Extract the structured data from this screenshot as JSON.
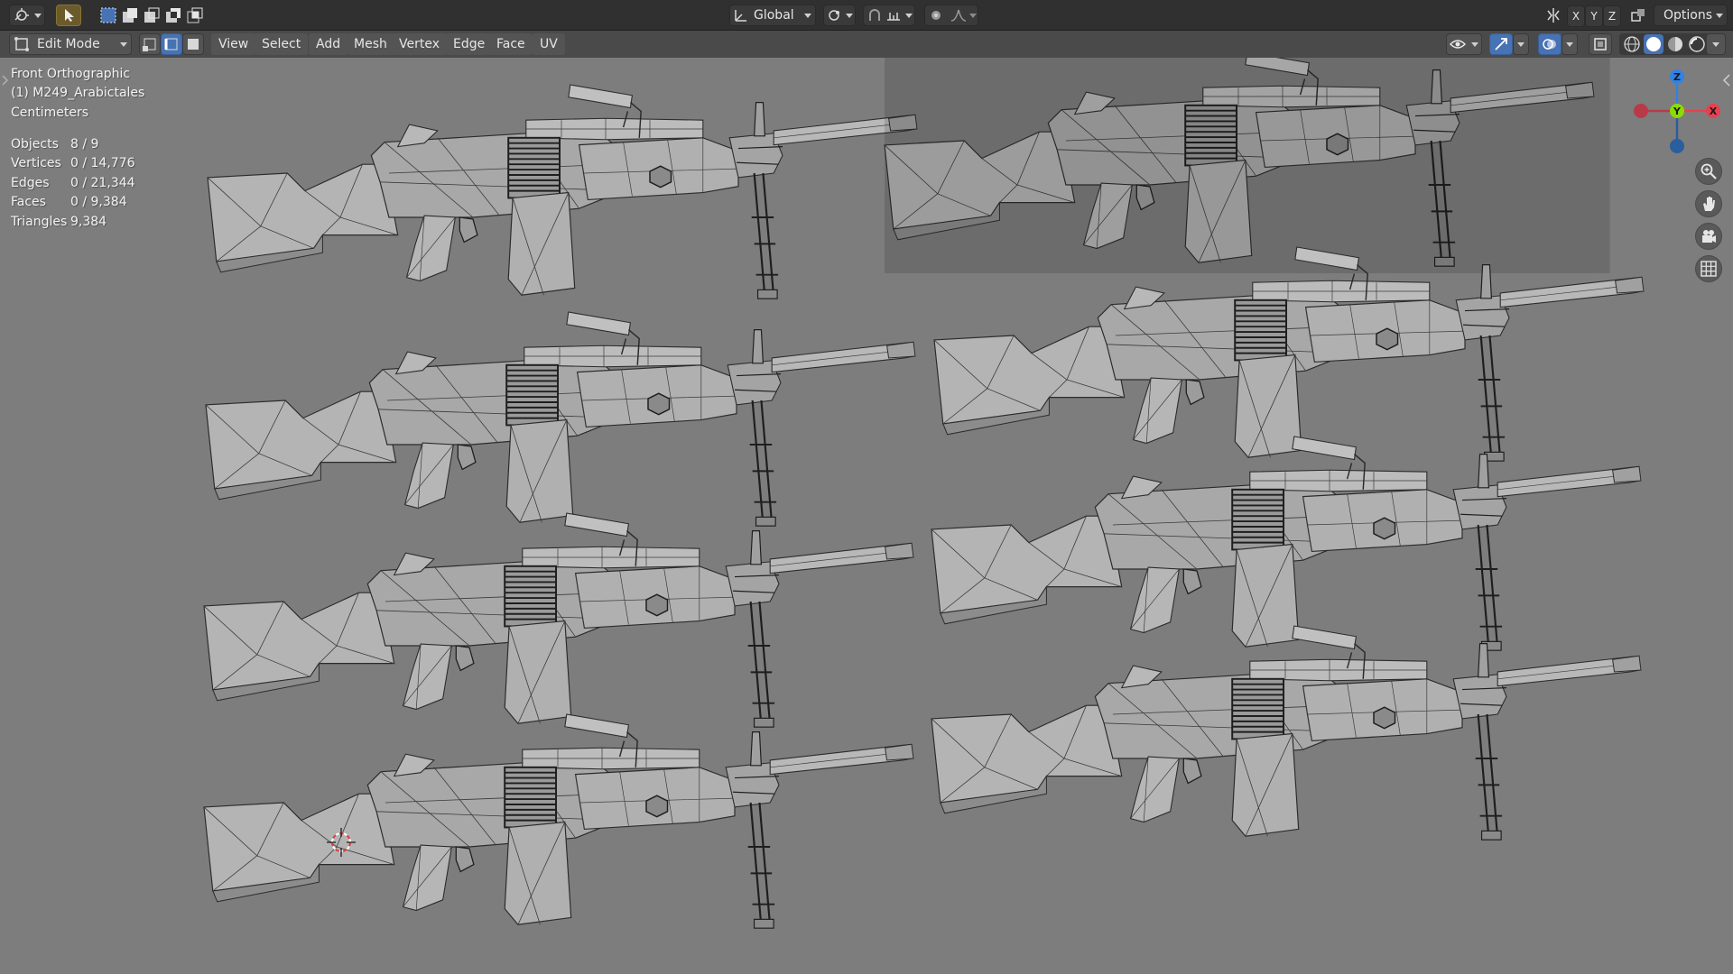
{
  "header": {
    "transform_orientation": "Global",
    "options_label": "Options",
    "axis_x": "X",
    "axis_y": "Y",
    "axis_z": "Z"
  },
  "toolbar": {
    "mode": "Edit Mode",
    "menus": [
      "View",
      "Select",
      "Add",
      "Mesh",
      "Vertex",
      "Edge",
      "Face",
      "UV"
    ]
  },
  "viewport": {
    "view_name": "Front Orthographic",
    "object_name": "(1) M249_Arabictales",
    "units": "Centimeters",
    "stats": [
      {
        "label": "Objects",
        "value": "8 / 9"
      },
      {
        "label": "Vertices",
        "value": "0 / 14,776"
      },
      {
        "label": "Edges",
        "value": "0 / 21,344"
      },
      {
        "label": "Faces",
        "value": "0 / 9,384"
      },
      {
        "label": "Triangles",
        "value": "9,384"
      }
    ]
  },
  "gizmo": {
    "z_label": "Z",
    "y_label": "Y",
    "x_label": "X",
    "colors": {
      "x": "#e8404f",
      "y": "#8bdc00",
      "z": "#2f83e6"
    }
  },
  "icons": {
    "editor_type": "editor-type-icon",
    "select": "cursor-select-icon",
    "box_select_modes": [
      "select-new-icon",
      "select-extend-icon",
      "select-subtract-icon",
      "select-difference-icon",
      "select-intersect-icon"
    ],
    "pivot": "pivot-point-icon",
    "snap": "snap-magnet-icon",
    "proportional": "proportional-edit-icon",
    "falloff": "falloff-curve-icon",
    "mirror_axes": "mirror-axis-icon",
    "mode_icon": "edit-mode-icon",
    "select_modes": [
      "vertex-select-icon",
      "edge-select-icon",
      "face-select-icon"
    ],
    "visibility": "eye-visibility-icon",
    "gizmo_toggle": "gizmo-toggle-icon",
    "overlay_toggle": "overlay-toggle-icon",
    "xray": "xray-toggle-icon",
    "shading": [
      "wireframe-shading-icon",
      "solid-shading-icon",
      "material-shading-icon",
      "rendered-shading-icon"
    ],
    "nav": [
      "zoom-icon",
      "pan-hand-icon",
      "camera-view-icon",
      "ortho-grid-icon"
    ],
    "cursor_3d": "3d-cursor-icon"
  },
  "model_instances": [
    {
      "name": "m249-instance-1",
      "shade": "light"
    },
    {
      "name": "m249-instance-2",
      "shade": "dark"
    },
    {
      "name": "m249-instance-3",
      "shade": "light"
    },
    {
      "name": "m249-instance-4",
      "shade": "light"
    },
    {
      "name": "m249-instance-5",
      "shade": "light"
    },
    {
      "name": "m249-instance-6",
      "shade": "light"
    },
    {
      "name": "m249-instance-7",
      "shade": "light"
    },
    {
      "name": "m249-instance-8",
      "shade": "light"
    }
  ]
}
